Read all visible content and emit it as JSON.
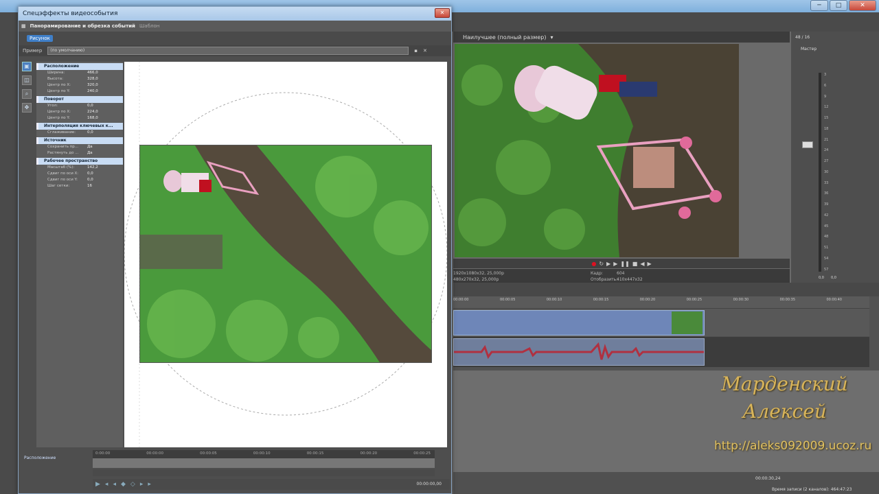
{
  "app": {
    "title": "",
    "win_controls": [
      "─",
      "□",
      "✕"
    ]
  },
  "dialog": {
    "title": "Спецэффекты видеособытия",
    "close": "✕",
    "header": {
      "tab_main": "Панорамирование и обрезка событий",
      "tab_extra": "Шаблон"
    },
    "tab": "Рисунок",
    "preset_label": "Пример",
    "preset_value": "(по умолчанию)",
    "sections": [
      {
        "title": "Расположение",
        "rows": [
          [
            "Ширина:",
            "466,0"
          ],
          [
            "Высота:",
            "328,0"
          ],
          [
            "Центр по X:",
            "320,0"
          ],
          [
            "Центр по Y:",
            "240,0"
          ]
        ]
      },
      {
        "title": "Поворот",
        "rows": [
          [
            "Угол:",
            "0,0"
          ],
          [
            "Центр по X:",
            "224,0"
          ],
          [
            "Центр по Y:",
            "168,0"
          ]
        ]
      },
      {
        "title": "Интерполяция ключевых к...",
        "rows": [
          [
            "Сглаживание:",
            "0,0"
          ]
        ]
      },
      {
        "title": "Источник",
        "rows": [
          [
            "Сохранить пр...",
            "Да"
          ],
          [
            "Растянуть до ...",
            "Да"
          ]
        ]
      },
      {
        "title": "Рабочее пространство",
        "rows": [
          [
            "Масштаб (%):",
            "142,2"
          ],
          [
            "Сдвиг по оси X:",
            "0,0"
          ],
          [
            "Сдвиг по оси Y:",
            "0,0"
          ],
          [
            "Шаг сетки:",
            "16"
          ]
        ]
      }
    ],
    "keyframes": {
      "label": "Расположение",
      "ruler": [
        "0:00:00",
        "00:00:00",
        "00:00:05",
        "00:00:10",
        "00:00:15",
        "00:00:20",
        "00:00:25"
      ],
      "time": "00:00:00,00"
    }
  },
  "preview": {
    "toolbar_label": "Наилучшее (полный размер)",
    "info": {
      "proj": "1920x1080x32, 25,000p",
      "prev": "480x270x32, 25,000p",
      "frame_label": "Кадр:",
      "frame": "604",
      "display_label": "Отобразить:",
      "display": "410x447x32"
    }
  },
  "mixer": {
    "count": "48 / 16",
    "master": "Мастер",
    "scale": [
      "3",
      "6",
      "9",
      "12",
      "15",
      "18",
      "21",
      "24",
      "27",
      "30",
      "33",
      "36",
      "39",
      "42",
      "45",
      "48",
      "51",
      "54",
      "57"
    ],
    "bottom": [
      "0,0",
      "0,0"
    ]
  },
  "timeline": {
    "ruler": [
      "00:00:00",
      "00:00:05",
      "00:00:10",
      "00:00:15",
      "00:00:20",
      "00:00:25",
      "00:00:30",
      "00:00:35",
      "00:00:40"
    ]
  },
  "status": {
    "time": "00:00:30,24",
    "record_time": "Время записи (2 каналов): 464:47:23"
  },
  "watermark": {
    "line1": "Марденский",
    "line2": "Алексей",
    "url": "http://aleks092009.ucoz.ru"
  }
}
